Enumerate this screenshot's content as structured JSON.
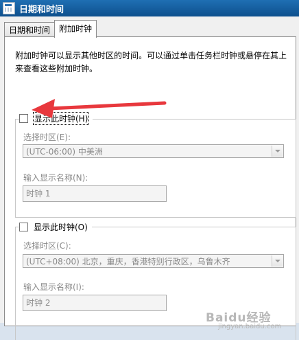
{
  "window": {
    "title": "日期和时间",
    "icon": "calendar-clock-icon"
  },
  "tabs": [
    {
      "label": "日期和时间",
      "active": false
    },
    {
      "label": "附加时钟",
      "active": true
    }
  ],
  "description": "附加时钟可以显示其他时区的时间。可以通过单击任务栏时钟或悬停在其上来查看这些附加时钟。",
  "clock1": {
    "checkbox_label": "显示此时钟(H)",
    "checked": false,
    "timezone_label": "选择时区(E):",
    "timezone_value": "(UTC-06:00) 中美洲",
    "name_label": "输入显示名称(N):",
    "name_value": "时钟 1"
  },
  "clock2": {
    "checkbox_label": "显示此时钟(O)",
    "checked": false,
    "timezone_label": "选择时区(C):",
    "timezone_value": "(UTC+08:00) 北京，重庆，香港特别行政区，乌鲁木齐",
    "name_label": "输入显示名称(I):",
    "name_value": "时钟 2"
  },
  "watermark": {
    "text": "Baidu经验",
    "sub": "jingyan.baidu.com"
  },
  "colors": {
    "annotation_arrow": "#e8383d",
    "titlebar": "#0d4f8d"
  }
}
